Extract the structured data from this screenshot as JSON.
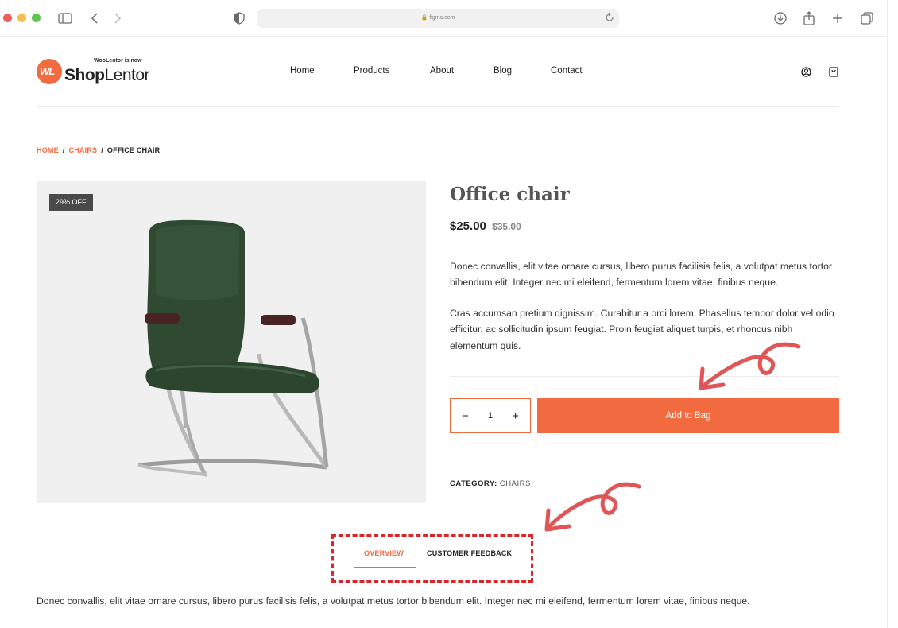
{
  "browser": {
    "url": "figma.com"
  },
  "header": {
    "logo_mark": "WL",
    "logo_small": "WooLentor is now",
    "logo_bold": "Shop",
    "logo_light": "Lentor",
    "nav": [
      "Home",
      "Products",
      "About",
      "Blog",
      "Contact"
    ],
    "icons": [
      "user-icon",
      "bag-icon"
    ]
  },
  "breadcrumb": {
    "items": [
      "HOME",
      "CHAIRS",
      "OFFICE CHAIR"
    ],
    "separator": "/"
  },
  "product": {
    "badge": "29% OFF",
    "title": "Office chair",
    "price": "$25.00",
    "old_price": "$35.00",
    "description": [
      "Donec convallis, elit vitae ornare cursus, libero purus facilisis felis, a volutpat metus tortor bibendum elit. Integer nec mi eleifend, fermentum lorem vitae, finibus neque.",
      "Cras accumsan pretium dignissim. Curabitur a orci lorem. Phasellus tempor dolor vel odio efficitur, ac sollicitudin ipsum feugiat. Proin feugiat aliquet turpis, et rhoncus nibh elementum quis."
    ],
    "quantity": "1",
    "minus": "−",
    "plus": "+",
    "add_to_bag": "Add to Bag",
    "category_label": "CATEGORY:",
    "category_value": "CHAIRS"
  },
  "tabs": {
    "items": [
      "OVERVIEW",
      "CUSTOMER FEEDBACK"
    ],
    "active": "OVERVIEW",
    "content": "Donec convallis, elit vitae ornare cursus, libero purus facilisis felis, a volutpat metus tortor bibendum elit. Integer nec mi eleifend, fermentum lorem vitae, finibus neque."
  },
  "colors": {
    "accent": "#f26a3f",
    "annotation": "#e05555",
    "highlight_box": "#d9262c"
  }
}
